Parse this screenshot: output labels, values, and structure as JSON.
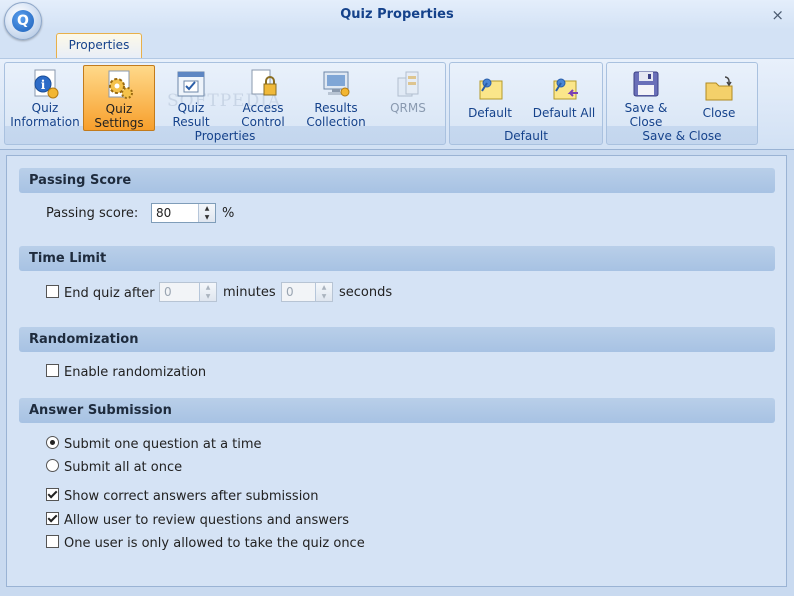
{
  "window": {
    "title": "Quiz Properties",
    "close_glyph": "×"
  },
  "ribbon": {
    "tab_label": "Properties",
    "watermark": "SOFTPEDIA",
    "groups": {
      "properties": {
        "label": "Properties",
        "buttons": [
          {
            "label_line1": "Quiz",
            "label_line2": "Information",
            "icon": "quiz-info-icon"
          },
          {
            "label_line1": "Quiz",
            "label_line2": "Settings",
            "icon": "quiz-settings-icon",
            "active": true
          },
          {
            "label_line1": "Quiz",
            "label_line2": "Result",
            "icon": "quiz-result-icon"
          },
          {
            "label_line1": "Access",
            "label_line2": "Control",
            "icon": "access-control-icon"
          },
          {
            "label_line1": "Results",
            "label_line2": "Collection",
            "icon": "results-collection-icon"
          },
          {
            "label_line1": "QRMS",
            "label_line2": "",
            "icon": "qrms-icon",
            "disabled": true
          }
        ]
      },
      "default": {
        "label": "Default",
        "buttons": [
          {
            "label_line1": "Default",
            "icon": "default-pin-icon"
          },
          {
            "label_line1": "Default All",
            "icon": "default-all-pin-icon"
          }
        ]
      },
      "save_close": {
        "label": "Save & Close",
        "buttons": [
          {
            "label_line1": "Save &",
            "label_line2": "Close",
            "icon": "save-floppy-icon"
          },
          {
            "label_line1": "Close",
            "icon": "close-folder-icon"
          }
        ]
      }
    }
  },
  "sections": {
    "passing": {
      "title": "Passing Score",
      "label": "Passing score:",
      "value": "80",
      "unit": "%"
    },
    "time": {
      "title": "Time Limit",
      "checkbox_label": "End quiz after",
      "checked": false,
      "minutes_value": "0",
      "minutes_label": "minutes",
      "seconds_value": "0",
      "seconds_label": "seconds"
    },
    "random": {
      "title": "Randomization",
      "checkbox_label": "Enable randomization",
      "checked": false
    },
    "submission": {
      "title": "Answer Submission",
      "radio_one": "Submit one question at a time",
      "radio_all": "Submit all at once",
      "selected": "one",
      "options": [
        {
          "label": "Show correct answers after submission",
          "checked": true
        },
        {
          "label": "Allow user to review questions and answers",
          "checked": true
        },
        {
          "label": "One user is only allowed to take the quiz once",
          "checked": false
        }
      ]
    }
  },
  "colors": {
    "title_text": "#15428b",
    "active_button": "#f79f2c",
    "content_bg": "#d5e3f5",
    "section_header_bg": "#a7c2e3"
  }
}
